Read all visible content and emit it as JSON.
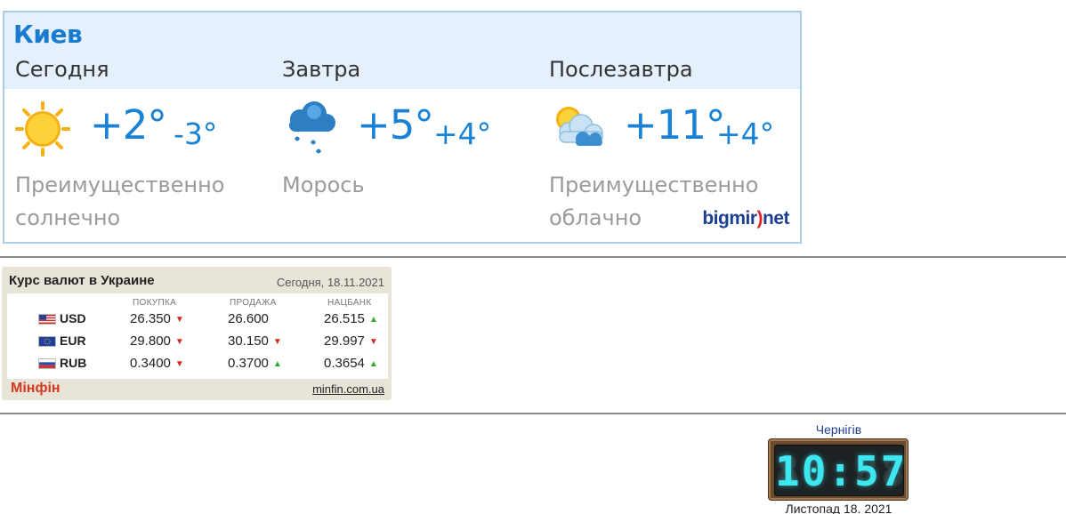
{
  "weather": {
    "city": "Киев",
    "days": [
      {
        "name": "Сегодня",
        "icon": "sun-icon",
        "temp_high": "+2°",
        "temp_low": "-3°",
        "condition_line1": "Преимущественно",
        "condition_line2": "солнечно"
      },
      {
        "name": "Завтра",
        "icon": "drizzle-cloud-icon",
        "temp_high": "+5°",
        "temp_low": "+4°",
        "condition_line1": "Морось",
        "condition_line2": ""
      },
      {
        "name": "Послезавтра",
        "icon": "partly-cloudy-icon",
        "temp_high": "+11°",
        "temp_low": "+4°",
        "condition_line1": "Преимущественно",
        "condition_line2": "облачно"
      }
    ],
    "brand_part1": "bigmir",
    "brand_bracket": ")",
    "brand_part2": "net"
  },
  "fx": {
    "title": "Курс валют в Украине",
    "date": "Сегодня, 18.11.2021",
    "headers": [
      "ПОКУПКА",
      "ПРОДАЖА",
      "НАЦБАНК"
    ],
    "rows": [
      {
        "code": "USD",
        "flag": "us-flag-icon",
        "buy": "26.350",
        "buy_dir": "down",
        "sell": "26.600",
        "sell_dir": "",
        "nbu": "26.515",
        "nbu_dir": "up"
      },
      {
        "code": "EUR",
        "flag": "eu-flag-icon",
        "buy": "29.800",
        "buy_dir": "down",
        "sell": "30.150",
        "sell_dir": "down",
        "nbu": "29.997",
        "nbu_dir": "down"
      },
      {
        "code": "RUB",
        "flag": "ru-flag-icon",
        "buy": "0.3400",
        "buy_dir": "down",
        "sell": "0.3700",
        "sell_dir": "up",
        "nbu": "0.3654",
        "nbu_dir": "up"
      }
    ],
    "brand": "Мінфін",
    "link": "minfin.com.ua"
  },
  "clock": {
    "city": "Чернігів",
    "time": "10:57",
    "ghost": "88:88",
    "date": "Листопад 18. 2021"
  },
  "colors": {
    "accent_blue": "#1a82d4",
    "arrow_down": "#d42a1c",
    "arrow_up": "#2faa2a",
    "clock_digits": "#3ee6f0"
  }
}
